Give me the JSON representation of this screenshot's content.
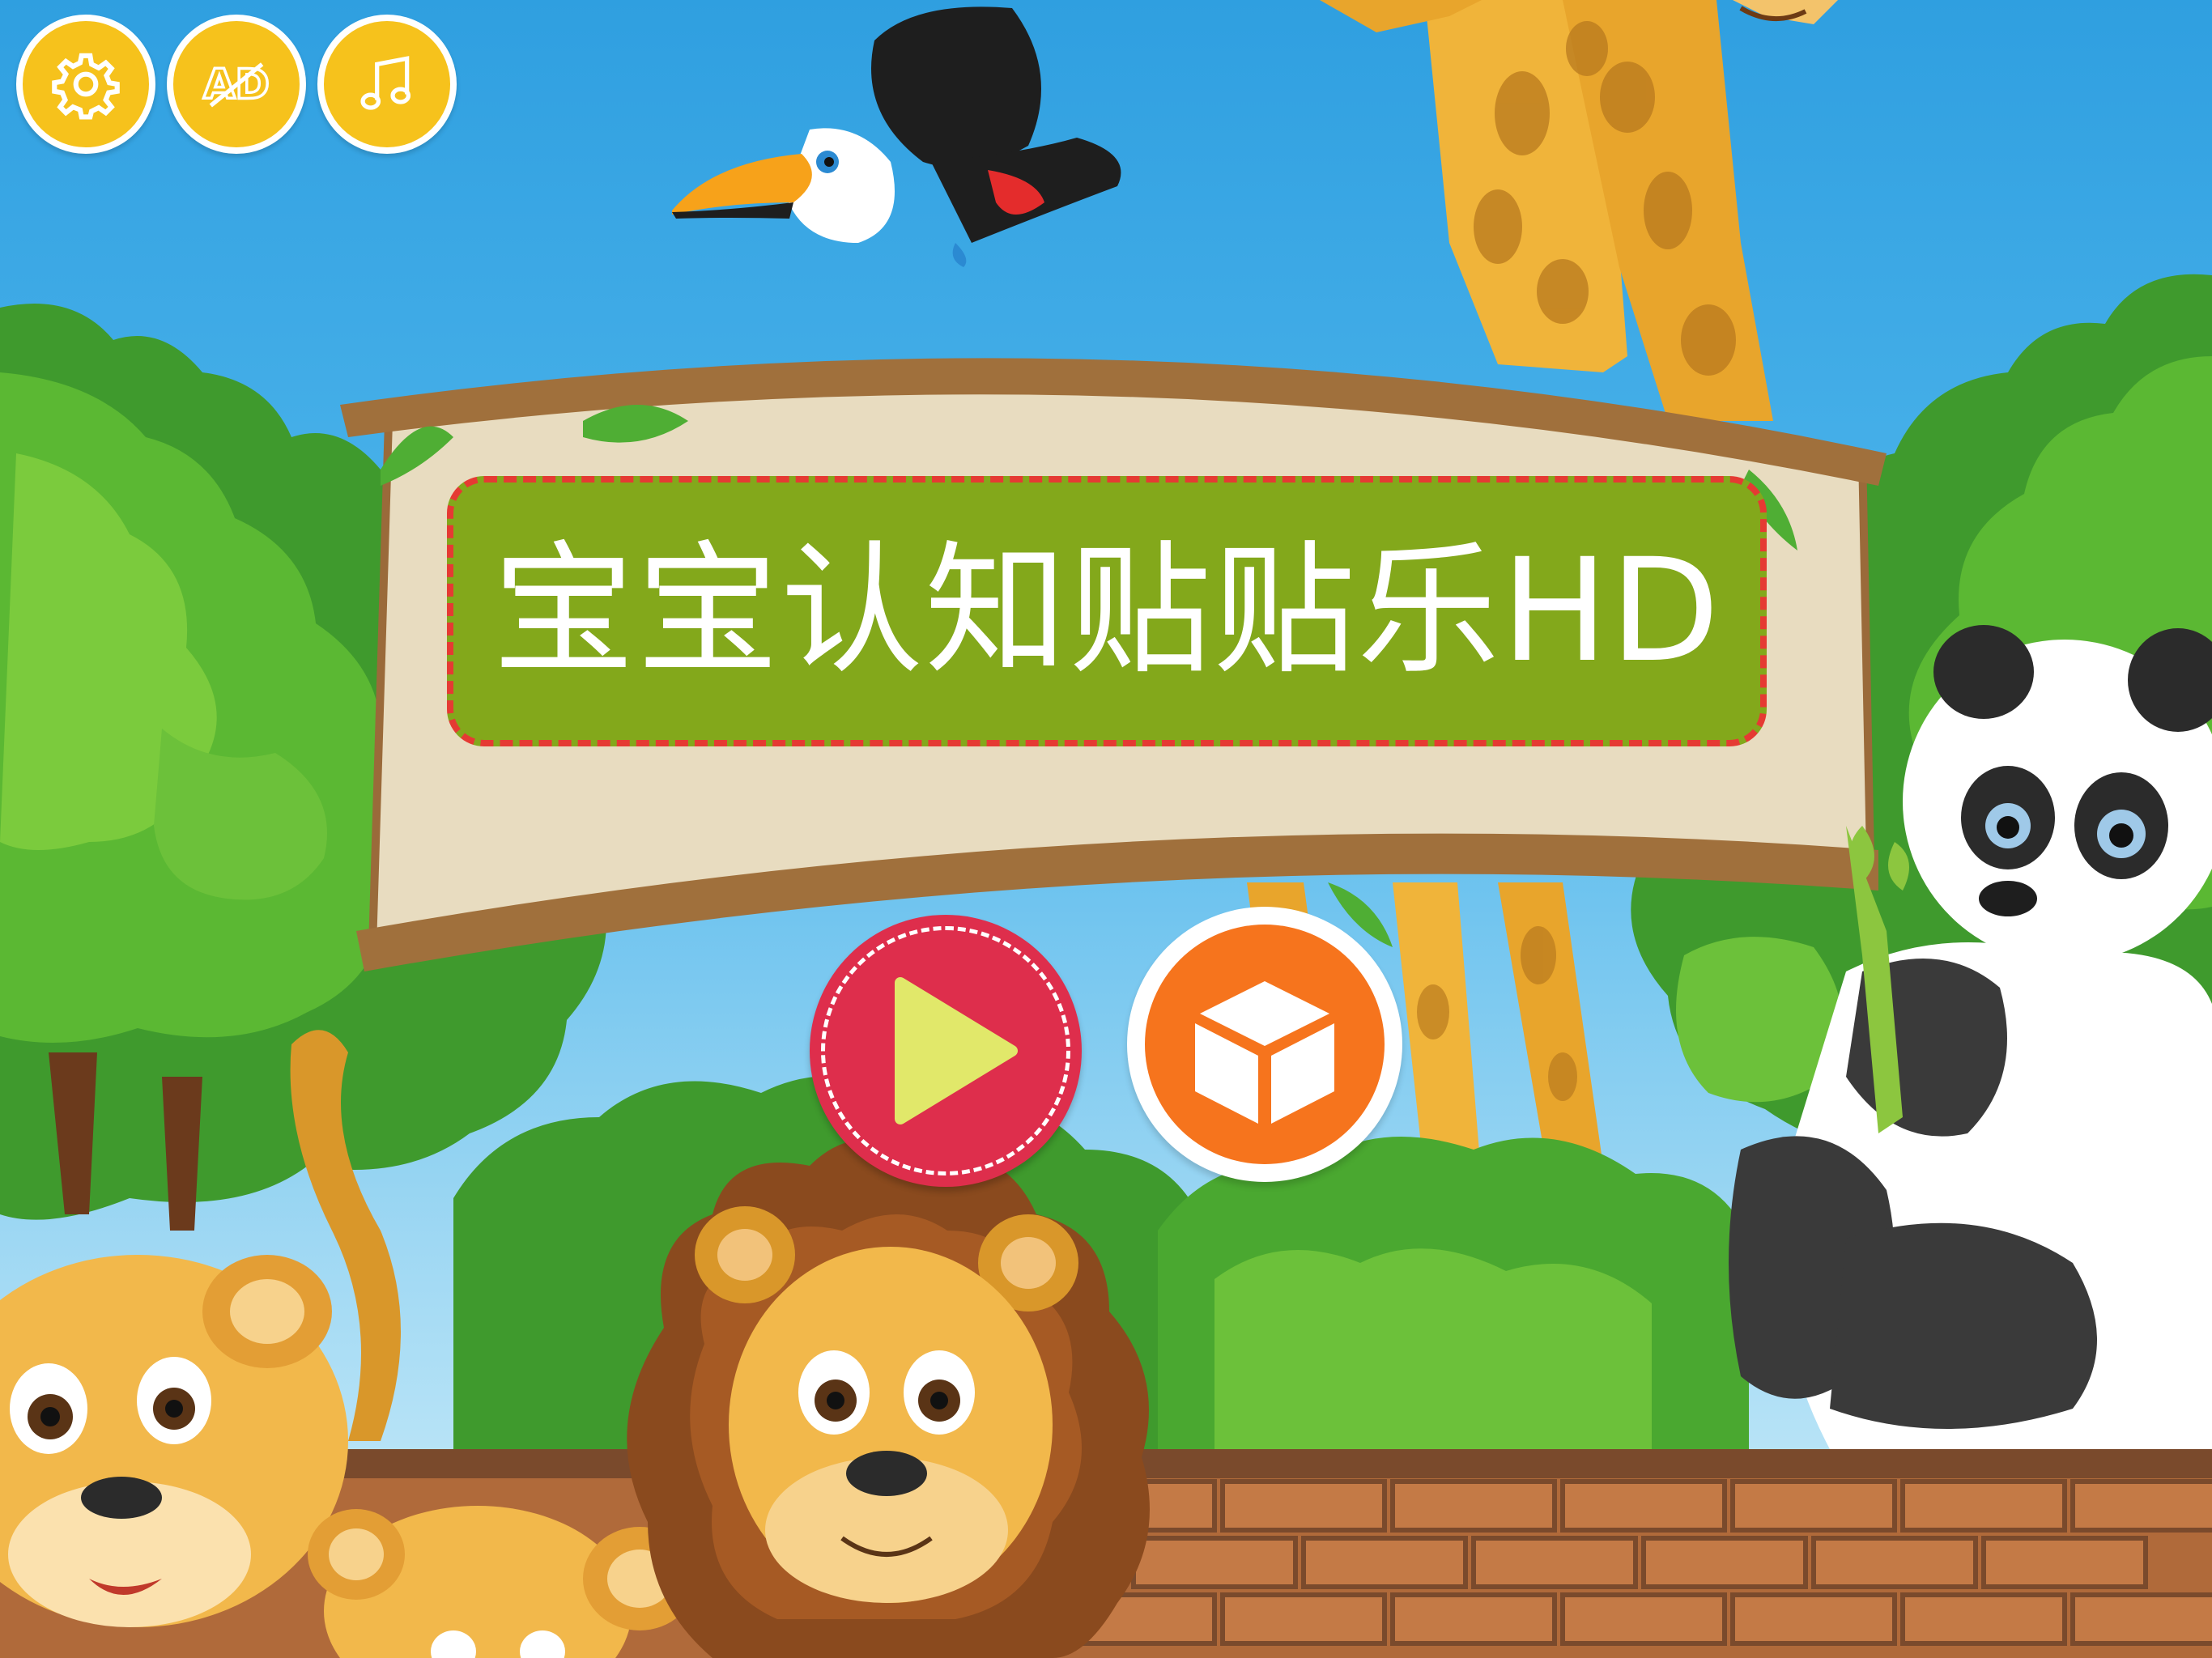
{
  "game": {
    "title": "宝宝认知贴贴乐HD"
  },
  "toolbar": {
    "settings_icon": "gear-icon",
    "ad_label": "AD",
    "music_icon": "music-note-icon"
  },
  "buttons": {
    "play_icon": "play-icon",
    "box_icon": "cube-icon"
  },
  "colors": {
    "toolbar_button": "#f6c21c",
    "title_background": "#83a81b",
    "title_border": "#e53a33",
    "play_button": "#de2e4c",
    "play_triangle": "#e1e86a",
    "cube_button": "#f6741d"
  }
}
